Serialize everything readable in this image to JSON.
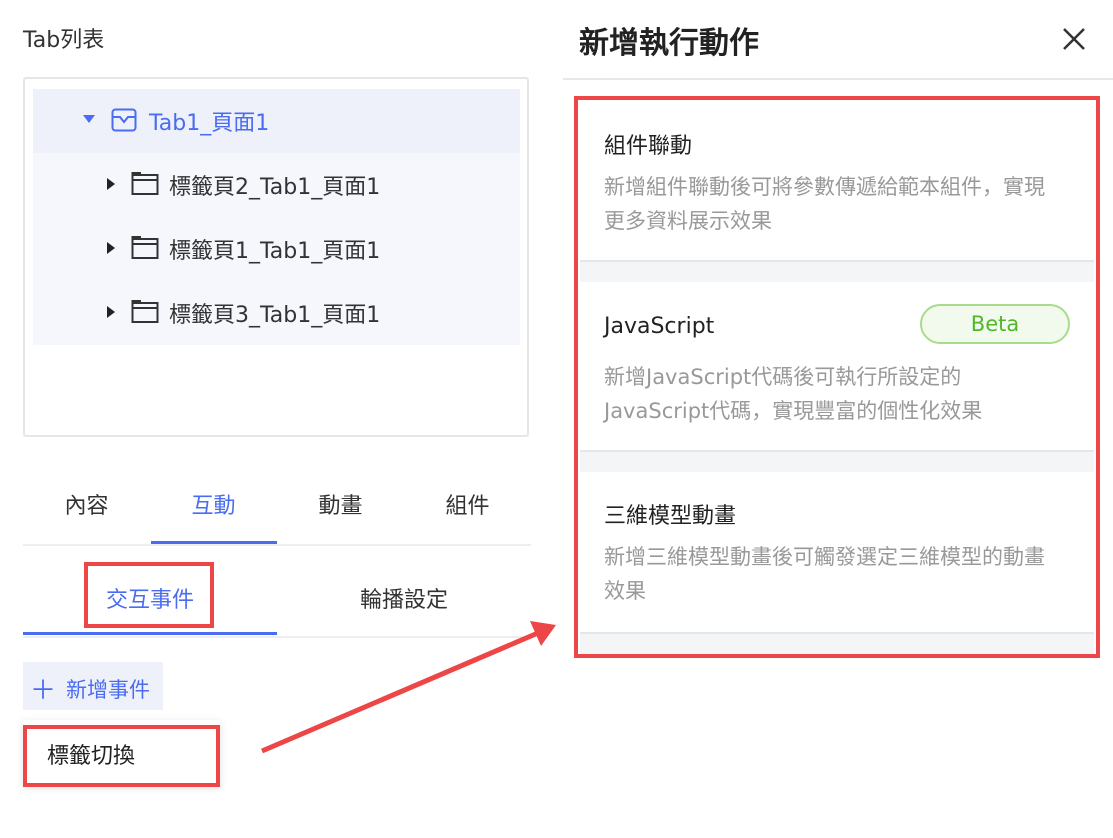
{
  "left_panel": {
    "tab_list_title": "Tab列表",
    "tree": {
      "root_label": "Tab1_頁面1",
      "children": [
        {
          "label": "標籤頁2_Tab1_頁面1"
        },
        {
          "label": "標籤頁1_Tab1_頁面1"
        },
        {
          "label": "標籤頁3_Tab1_頁面1"
        }
      ]
    },
    "main_tabs": [
      {
        "label": "內容"
      },
      {
        "label": "互動",
        "active": true
      },
      {
        "label": "動畫"
      },
      {
        "label": "組件"
      }
    ],
    "sub_tabs": [
      {
        "label": "交互事件",
        "active": true
      },
      {
        "label": "輪播設定"
      }
    ],
    "add_event_label": "新增事件",
    "dropdown_item_label": "標籤切換"
  },
  "right_panel": {
    "title": "新增執行動作",
    "actions": [
      {
        "title": "組件聯動",
        "desc": "新增組件聯動後可將參數傳遞給範本組件，實現更多資料展示效果"
      },
      {
        "title": "JavaScript",
        "badge": "Beta",
        "desc": "新增JavaScript代碼後可執行所設定的JavaScript代碼，實現豐富的個性化效果"
      },
      {
        "title": "三維模型動畫",
        "desc": "新增三維模型動畫後可觸發選定三維模型的動畫效果"
      }
    ]
  },
  "colors": {
    "accent": "#4a6cf0",
    "highlight": "#ec4646",
    "beta_green": "#52b62a"
  }
}
